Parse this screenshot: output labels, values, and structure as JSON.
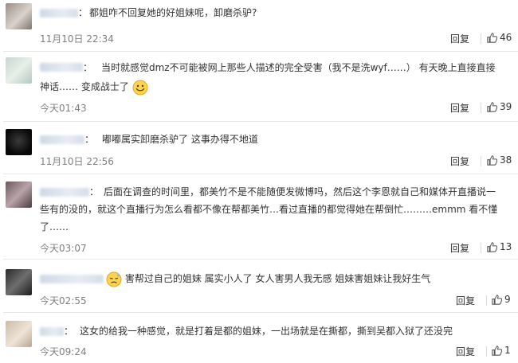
{
  "comments": [
    {
      "text": "都姐咋不回复她的好姐妹呢，卸磨杀驴?",
      "time": "11月10日 22:34",
      "reply_label": "回复",
      "likes": "46"
    },
    {
      "text1": "当时就感觉dmz不可能被网上那些人描述的完全受害（我不是洗wyf……）  有天晚上直接直接",
      "text2": "神话…… 变成战士了",
      "time": "今天01:43",
      "reply_label": "回复",
      "likes": "39"
    },
    {
      "text": "嘟嘟属实卸磨杀驴了 这事办得不地道",
      "time": "11月10日 22:56",
      "reply_label": "回复",
      "likes": "38"
    },
    {
      "text1": "后面在调查的时间里，都美竹不是不能随便发微博吗，然后这个李恩就自己和媒体开直播说一",
      "text2": "些有的没的，就这个直播行为怎么看都不像在帮都美竹…看过直播的都觉得她在帮倒忙………emmm 看不懂",
      "text3": "了……",
      "time": "今天03:07",
      "reply_label": "回复",
      "likes": "13"
    },
    {
      "text": "害帮过自己的姐妹 属实小人了 女人害男人我无感 姐妹害姐妹让我好生气",
      "time": "今天02:55",
      "reply_label": "回复",
      "likes": "9"
    },
    {
      "text": "这女的给我一种感觉，就是打着是都的姐妹，一出场就是在撕都，撕到吴都入狱了还没完",
      "time": "今天09:24",
      "reply_label": "回复",
      "likes": "1"
    }
  ],
  "colon": "：",
  "colors": {
    "text": "#333333",
    "meta": "#808080",
    "divider": "#e6e6e6"
  },
  "icons": {
    "like": "thumbs-up-icon",
    "smile": "smile-emoji-icon",
    "pensive": "thinking-emoji-icon"
  }
}
